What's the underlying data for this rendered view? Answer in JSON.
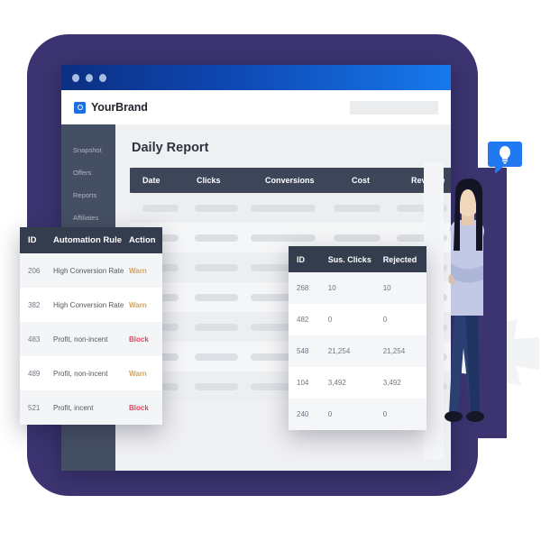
{
  "window": {
    "dots": [
      "dot-1",
      "dot-2",
      "dot-3"
    ],
    "brand_name": "YourBrand",
    "brand_logo_icon": "brand-square-logo",
    "search_placeholder": ""
  },
  "sidebar": {
    "items": [
      {
        "label": "Snapshot"
      },
      {
        "label": "Offers"
      },
      {
        "label": "Reports"
      },
      {
        "label": "Affiliates"
      }
    ]
  },
  "main": {
    "page_title": "Daily Report",
    "report_table": {
      "columns": [
        "Date",
        "Clicks",
        "Conversions",
        "Cost",
        "Revenue"
      ],
      "rows": [
        {
          "placeholder": true
        },
        {
          "placeholder": true
        },
        {
          "placeholder": true
        },
        {
          "placeholder": true
        },
        {
          "placeholder": true
        }
      ]
    }
  },
  "rules_table": {
    "columns": [
      "ID",
      "Automation Rule",
      "Action"
    ],
    "rows": [
      {
        "id": "206",
        "rule": "High Conversion Rate",
        "action": "Warn",
        "action_type": "warn"
      },
      {
        "id": "382",
        "rule": "High Conversion Rate",
        "action": "Warn",
        "action_type": "warn"
      },
      {
        "id": "483",
        "rule": "Profit, non-incent",
        "action": "Block",
        "action_type": "block"
      },
      {
        "id": "489",
        "rule": "Profit, non-incent",
        "action": "Warn",
        "action_type": "warn"
      },
      {
        "id": "521",
        "rule": "Profit, incent",
        "action": "Block",
        "action_type": "block"
      }
    ]
  },
  "sus_table": {
    "columns": [
      "ID",
      "Sus. Clicks",
      "Rejected"
    ],
    "rows": [
      {
        "id": "268",
        "sus_clicks": "10",
        "rejected": "10"
      },
      {
        "id": "482",
        "sus_clicks": "0",
        "rejected": "0"
      },
      {
        "id": "548",
        "sus_clicks": "21,254",
        "rejected": "21,254"
      },
      {
        "id": "104",
        "sus_clicks": "3,492",
        "rejected": "3,492"
      },
      {
        "id": "240",
        "sus_clicks": "0",
        "rejected": "0"
      }
    ]
  },
  "illustration": {
    "bubble_icon": "lightbulb-icon",
    "gear_icon": "gear-icon",
    "person_icon": "person-illustration"
  },
  "colors": {
    "panel_purple": "#3b3470",
    "titlebar_from": "#0c2f82",
    "titlebar_to": "#1779ec",
    "table_header": "#343d4e",
    "sidebar": "#454f63",
    "accent_blue": "#1f6fe0",
    "warn": "#dca14e",
    "block": "#e0455f"
  }
}
